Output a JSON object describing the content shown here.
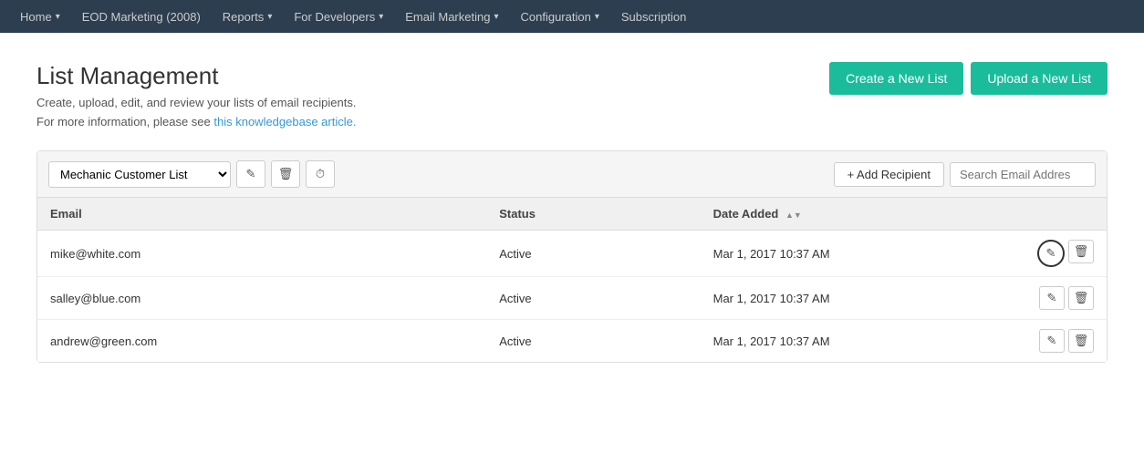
{
  "navbar": {
    "items": [
      {
        "label": "Home",
        "hasDropdown": true
      },
      {
        "label": "EOD Marketing (2008)",
        "hasDropdown": false
      },
      {
        "label": "Reports",
        "hasDropdown": true
      },
      {
        "label": "For Developers",
        "hasDropdown": true
      },
      {
        "label": "Email Marketing",
        "hasDropdown": true
      },
      {
        "label": "Configuration",
        "hasDropdown": true
      },
      {
        "label": "Subscription",
        "hasDropdown": false
      }
    ]
  },
  "page": {
    "title": "List Management",
    "subtitle": "Create, upload, edit, and review your lists of email recipients.",
    "info_prefix": "For more information, please see ",
    "info_link_text": "this knowledgebase article.",
    "info_link_href": "#"
  },
  "header_buttons": {
    "create_label": "Create a New List",
    "upload_label": "Upload a New List"
  },
  "toolbar": {
    "list_selected": "Mechanic Customer List",
    "add_recipient_label": "+ Add Recipient",
    "search_placeholder": "Search Email Addres"
  },
  "table": {
    "columns": [
      {
        "id": "email",
        "label": "Email",
        "sortable": false
      },
      {
        "id": "status",
        "label": "Status",
        "sortable": false
      },
      {
        "id": "date_added",
        "label": "Date Added",
        "sortable": true
      }
    ],
    "rows": [
      {
        "email": "mike@white.com",
        "status": "Active",
        "date_added": "Mar 1, 2017 10:37 AM",
        "edit_circled": true
      },
      {
        "email": "salley@blue.com",
        "status": "Active",
        "date_added": "Mar 1, 2017 10:37 AM",
        "edit_circled": false
      },
      {
        "email": "andrew@green.com",
        "status": "Active",
        "date_added": "Mar 1, 2017 10:37 AM",
        "edit_circled": false
      }
    ]
  }
}
